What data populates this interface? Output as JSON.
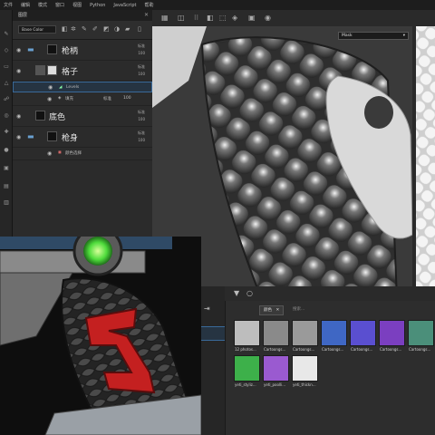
{
  "menubar": [
    "文件",
    "编辑",
    "模式",
    "窗口",
    "视图",
    "Python",
    "JavaScript",
    "帮助"
  ],
  "layers_panel": {
    "title": "图层",
    "channel": "Base Color",
    "layers": [
      {
        "name": "枪柄",
        "blend": "标准",
        "opacity": "100"
      },
      {
        "name": "格子",
        "blend": "标准",
        "opacity": "100",
        "effects": [
          {
            "name": "Levels",
            "blend": "标准",
            "opacity": "100"
          },
          {
            "name": "填充",
            "blend": "标准",
            "opacity": "100"
          }
        ]
      },
      {
        "name": "底色",
        "blend": "标准",
        "opacity": "100"
      },
      {
        "name": "枪身",
        "blend": "标准",
        "opacity": "100",
        "effects": [
          {
            "name": "颜色选择",
            "blend": "",
            "opacity": ""
          }
        ]
      }
    ]
  },
  "viewport": {
    "mode": "Mask"
  },
  "shelf": {
    "filter_tag": "颜色",
    "search_placeholder": "搜索...",
    "assets": [
      {
        "label": "12 photos...",
        "color": "#bdbdbd"
      },
      {
        "label": "Cartoongs...",
        "color": "#8a8a8a"
      },
      {
        "label": "Cartoongs...",
        "color": "#9a9a9a"
      },
      {
        "label": "Cartoongs...",
        "color": "#3f67c4"
      },
      {
        "label": "Cartoongs...",
        "color": "#5a4fd0"
      },
      {
        "label": "Cartoongs...",
        "color": "#7b3fc0"
      },
      {
        "label": "Cartoongs...",
        "color": "#4b8f7a"
      },
      {
        "label": "yeti_styliz...",
        "color": "#3db04a"
      },
      {
        "label": "yeti_poolli...",
        "color": "#9a5ad0"
      },
      {
        "label": "yeti_thickn...",
        "color": "#e8e8e8"
      }
    ]
  }
}
